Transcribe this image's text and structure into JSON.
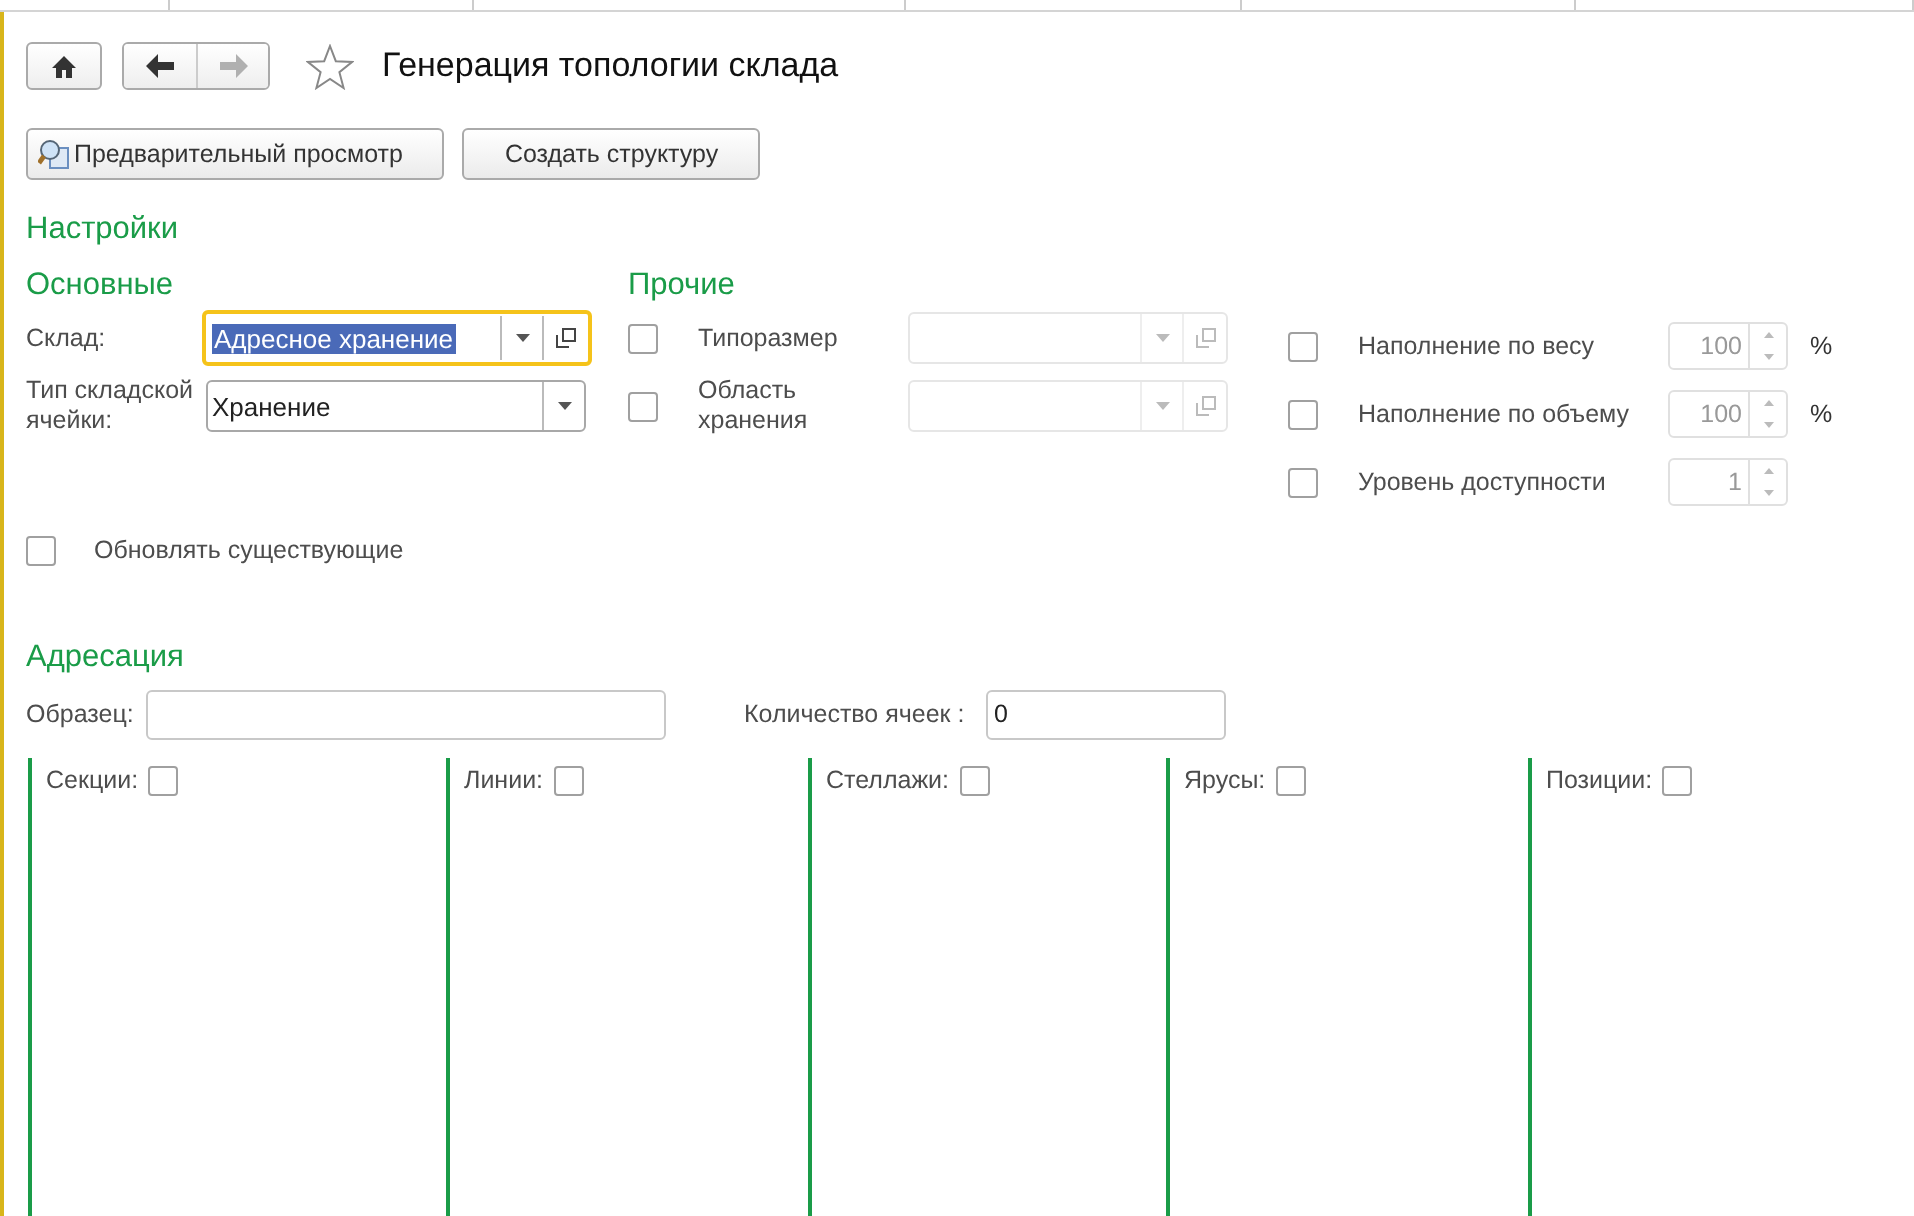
{
  "navigation": {
    "back": {
      "disabled": false
    },
    "forward": {
      "disabled": true
    }
  },
  "favorite": false,
  "title": "Генерация топологии склада",
  "commands": [
    {
      "label": "Предварительный просмотр",
      "kind": "preview"
    },
    {
      "label": "Создать структуру",
      "kind": "plain"
    }
  ],
  "settings": {
    "title": "Настройки",
    "main": {
      "title": "Основные",
      "fields": [
        {
          "label": "Склад:",
          "value": "Адресное хранение",
          "focused": true,
          "open_button": true
        },
        {
          "label": "Тип складской ячейки:",
          "value": "Хранение",
          "focused": false,
          "open_button": false
        }
      ]
    },
    "other": {
      "title": "Прочие",
      "fields": [
        {
          "label": "Типоразмер",
          "checked": false,
          "disabled": true
        },
        {
          "label": "Область хранения",
          "checked": false,
          "disabled": true
        }
      ]
    },
    "limits": [
      {
        "label": "Наполнение по весу",
        "checked": false,
        "value": "100",
        "unit": "%",
        "disabled": true
      },
      {
        "label": "Наполнение по объему",
        "checked": false,
        "value": "100",
        "unit": "%",
        "disabled": true
      },
      {
        "label": "Уровень доступности",
        "checked": false,
        "value": "1",
        "disabled": true
      }
    ],
    "update_existing": {
      "label": "Обновлять существующие",
      "checked": false
    }
  },
  "addressing": {
    "title": "Адресация",
    "sample": {
      "label": "Образец:"
    },
    "cell_count": {
      "label": "Количество ячеек :",
      "value": "0"
    },
    "levels": [
      {
        "label": "Секции:",
        "checked": false
      },
      {
        "label": "Линии:",
        "checked": false
      },
      {
        "label": "Стеллажи:",
        "checked": false
      },
      {
        "label": "Ярусы:",
        "checked": false
      },
      {
        "label": "Позиции:",
        "checked": false
      }
    ]
  }
}
